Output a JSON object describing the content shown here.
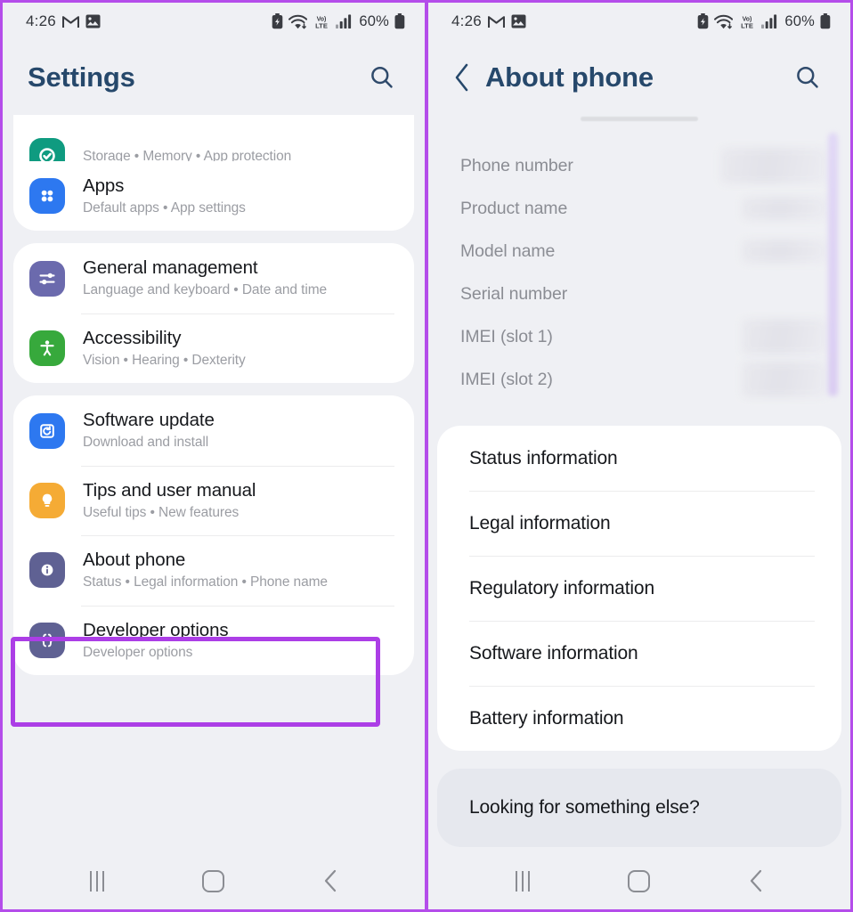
{
  "status_bar": {
    "time": "4:26",
    "battery_percent": "60%",
    "left_icons": [
      "gmail-icon",
      "photos-icon"
    ],
    "right_icons": [
      "battery-saver-icon",
      "wifi-icon",
      "volte-icon",
      "signal-bars-icon",
      "battery-icon"
    ]
  },
  "colors": {
    "highlight": "#ac3ee6",
    "frame": "#b44dea",
    "header_title": "#26486b",
    "page_bg": "#eff0f4",
    "card_bg": "#ffffff"
  },
  "left_panel": {
    "header": {
      "title": "Settings",
      "search_icon": "search-icon"
    },
    "groups": [
      {
        "partial_row": {
          "subtitle": "Storage  •  Memory  •  App protection",
          "icon_color": "#0f9b80",
          "icon_name": "device-care-icon"
        },
        "rows": [
          {
            "title": "Apps",
            "subtitle": "Default apps  •  App settings",
            "icon_color": "#2d78f0",
            "icon_name": "apps-icon"
          }
        ]
      },
      {
        "rows": [
          {
            "title": "General management",
            "subtitle": "Language and keyboard  •  Date and time",
            "icon_color": "#6b6aad",
            "icon_name": "sliders-icon"
          },
          {
            "title": "Accessibility",
            "subtitle": "Vision  •  Hearing  •  Dexterity",
            "icon_color": "#37a93c",
            "icon_name": "accessibility-icon"
          }
        ]
      },
      {
        "rows": [
          {
            "title": "Software update",
            "subtitle": "Download and install",
            "icon_color": "#2d78f0",
            "icon_name": "software-update-icon"
          },
          {
            "title": "Tips and user manual",
            "subtitle": "Useful tips  •  New features",
            "icon_color": "#f5ab35",
            "icon_name": "lightbulb-icon"
          },
          {
            "title": "About phone",
            "subtitle": "Status  •  Legal information  •  Phone name",
            "icon_color": "#5f6193",
            "icon_name": "info-icon",
            "highlighted": true
          },
          {
            "title": "Developer options",
            "subtitle": "Developer options",
            "icon_color": "#5f6193",
            "icon_name": "developer-options-icon"
          }
        ]
      }
    ]
  },
  "right_panel": {
    "header": {
      "title": "About phone",
      "back_icon": "chevron-left-icon",
      "search_icon": "search-icon"
    },
    "device_info": [
      {
        "label": "Phone number",
        "value_redacted": true
      },
      {
        "label": "Product name",
        "value_redacted": true
      },
      {
        "label": "Model name",
        "value_redacted": true
      },
      {
        "label": "Serial number",
        "value_redacted": true
      },
      {
        "label": "IMEI (slot 1)",
        "value_redacted": true
      },
      {
        "label": "IMEI (slot 2)",
        "value_redacted": true
      }
    ],
    "menu_items": [
      "Status information",
      "Legal information",
      "Regulatory information",
      "Software information",
      "Battery information"
    ],
    "footer_prompt": "Looking for something else?"
  },
  "nav_bar": {
    "recents_label": "recents-icon",
    "home_label": "home-icon",
    "back_label": "back-icon"
  }
}
